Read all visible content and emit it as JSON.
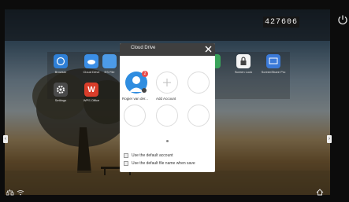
{
  "status_bar": {
    "code": "427606"
  },
  "apps": [
    {
      "label": "Browser",
      "icon": "browser-icon",
      "color": "#2e7fd6"
    },
    {
      "label": "Cloud Drive",
      "icon": "cloud-drive-icon",
      "color": "#3a8ee6"
    },
    {
      "label": "ES File",
      "icon": "folder-icon",
      "color": "#4c9be8"
    },
    {
      "label": "Settings",
      "icon": "settings-gear-icon",
      "color": "#4a4a4a"
    },
    {
      "label": "WPS Office",
      "icon": "wps-office-icon",
      "color": "#d93d2a"
    },
    {
      "label": "",
      "icon": "green-app-icon",
      "color": "#3aa35a"
    },
    {
      "label": "Screen Lock",
      "icon": "lock-icon",
      "color": "#f4f4f4"
    },
    {
      "label": "ScreenShare Pro",
      "icon": "screenshare-icon",
      "color": "#3b7ad8"
    }
  ],
  "dialog": {
    "title": "Cloud Drive",
    "account_name": "Rogier van der...",
    "account_badge": "2",
    "add_account_label": "Add Account",
    "options": [
      {
        "label": "Use the default account"
      },
      {
        "label": "Use the default file name when save"
      }
    ]
  },
  "colors": {
    "dialog_header": "#3f3f3f",
    "avatar": "#2f8de0",
    "code_box": "#161616"
  }
}
